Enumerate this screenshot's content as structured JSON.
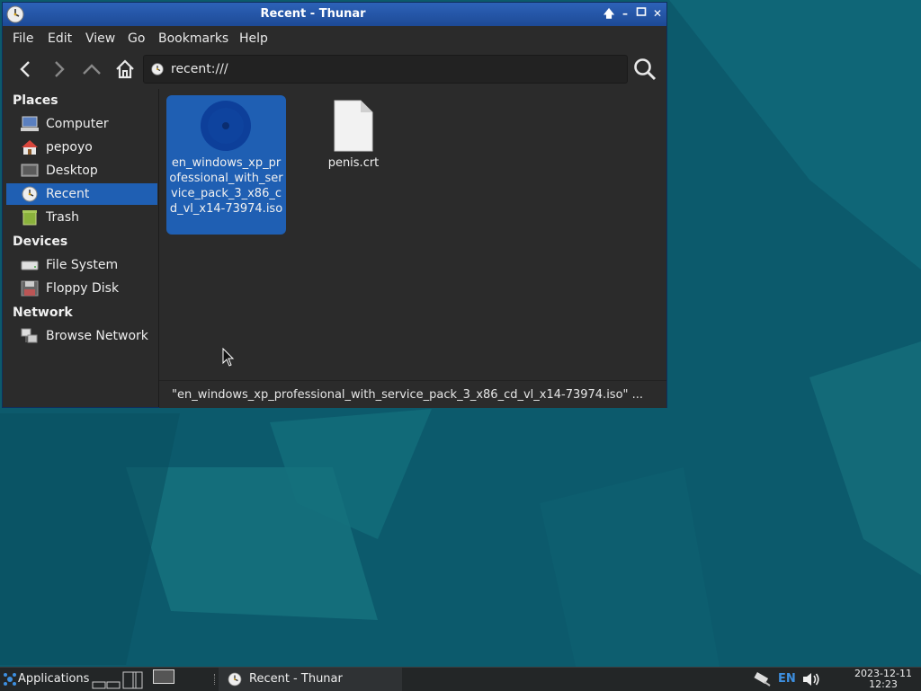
{
  "window": {
    "title": "Recent - Thunar",
    "menu": [
      "File",
      "Edit",
      "View",
      "Go",
      "Bookmarks",
      "Help"
    ],
    "location": "recent:///"
  },
  "sidebar": {
    "places_heading": "Places",
    "places": [
      {
        "label": "Computer",
        "icon": "computer-icon"
      },
      {
        "label": "pepoyo",
        "icon": "home-folder-icon"
      },
      {
        "label": "Desktop",
        "icon": "desktop-icon"
      },
      {
        "label": "Recent",
        "icon": "recent-clock-icon"
      },
      {
        "label": "Trash",
        "icon": "trash-icon"
      }
    ],
    "devices_heading": "Devices",
    "devices": [
      {
        "label": "File System",
        "icon": "drive-icon"
      },
      {
        "label": "Floppy Disk",
        "icon": "floppy-icon"
      }
    ],
    "network_heading": "Network",
    "network": [
      {
        "label": "Browse Network",
        "icon": "network-icon"
      }
    ]
  },
  "files": [
    {
      "name": "en_windows_xp_professional_with_service_pack_3_x86_cd_vl_x14-73974.iso",
      "icon": "disc-image-icon"
    },
    {
      "name": "penis.crt",
      "icon": "document-icon"
    }
  ],
  "status": "\"en_windows_xp_professional_with_service_pack_3_x86_cd_vl_x14-73974.iso\" ...",
  "taskbar": {
    "applications_label": "Applications",
    "task_label": "Recent - Thunar",
    "language": "EN",
    "date": "2023-12-11",
    "time": "12:23"
  },
  "colors": {
    "selection": "#1f5fb3",
    "titlebar": "#2d62b8",
    "desktop": "#0d5b6e"
  }
}
